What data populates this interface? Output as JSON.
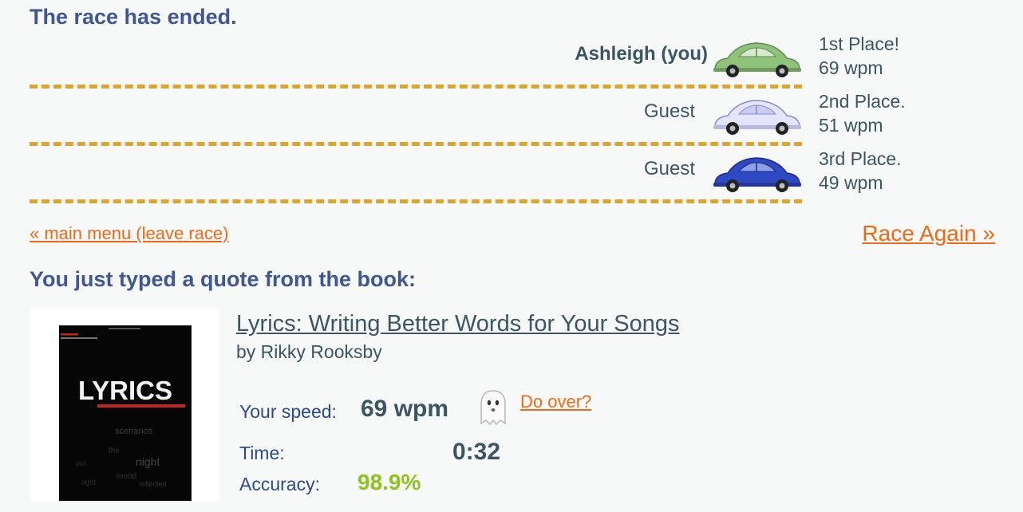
{
  "header": {
    "title": "The race has ended."
  },
  "race": {
    "racers": [
      {
        "name": "Ashleigh (you)",
        "place": "1st Place!",
        "speed": "69 wpm",
        "car_color": "#8fc27a"
      },
      {
        "name": "Guest",
        "place": "2nd Place.",
        "speed": "51 wpm",
        "car_color": "#dcdcff"
      },
      {
        "name": "Guest",
        "place": "3rd Place.",
        "speed": "49 wpm",
        "car_color": "#2f48c4"
      }
    ],
    "track_color": "#dea52b"
  },
  "nav": {
    "main_menu_label": "« main menu (leave race)",
    "race_again_label": "Race Again »"
  },
  "quote": {
    "heading": "You just typed a quote from the book:",
    "book_title": "Lyrics: Writing Better Words for Your Songs",
    "author": "by Rikky Rooksby",
    "cover_text": "LYRICS"
  },
  "stats": {
    "speed_label": "Your speed:",
    "speed_value": "69 wpm",
    "do_over_label": "Do over?",
    "time_label": "Time:",
    "time_value": "0:32",
    "accuracy_label": "Accuracy:",
    "accuracy_value": "98.9%",
    "accuracy_color": "#8dc21f"
  },
  "colors": {
    "heading": "#3f5796",
    "link": "#f06a16",
    "text": "#3b5662"
  }
}
